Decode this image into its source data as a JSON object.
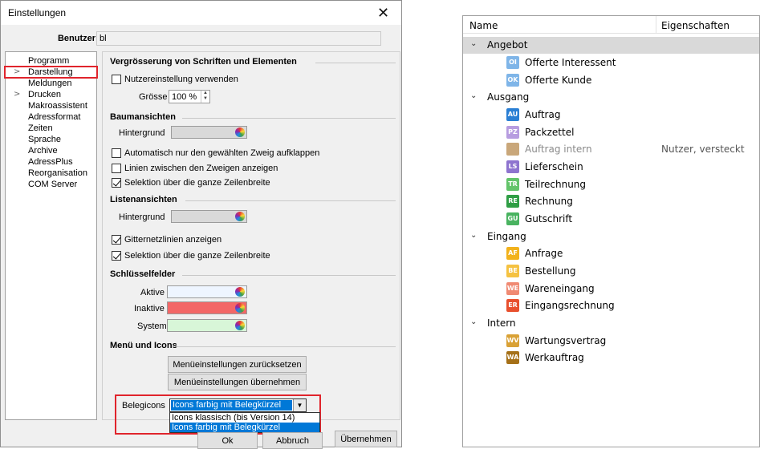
{
  "dialog": {
    "title": "Einstellungen",
    "close_glyph": "✕",
    "user_label": "Benutzer",
    "user_value": "bl"
  },
  "nav": {
    "items": [
      {
        "label": "Programm",
        "expandable": false
      },
      {
        "label": "Darstellung",
        "expandable": true,
        "selected": true
      },
      {
        "label": "Meldungen",
        "expandable": false
      },
      {
        "label": "Drucken",
        "expandable": true
      },
      {
        "label": "Makroassistent",
        "expandable": false
      },
      {
        "label": "Adressformat",
        "expandable": false
      },
      {
        "label": "Zeiten",
        "expandable": false
      },
      {
        "label": "Sprache",
        "expandable": false
      },
      {
        "label": "Archive",
        "expandable": false
      },
      {
        "label": "AdressPlus",
        "expandable": false
      },
      {
        "label": "Reorganisation",
        "expandable": false
      },
      {
        "label": "COM Server",
        "expandable": false
      }
    ]
  },
  "sections": {
    "zoom": {
      "title": "Vergrösserung von Schriften und Elementen",
      "use_user_setting": "Nutzereinstellung verwenden",
      "size_label": "Grösse",
      "size_value": "100 %"
    },
    "tree_views": {
      "title": "Baumansichten",
      "background_label": "Hintergrund",
      "auto_expand": "Automatisch nur den gewählten Zweig aufklappen",
      "lines_between": "Linien zwischen den Zweigen anzeigen",
      "full_row_select": "Selektion über die ganze Zeilenbreite"
    },
    "list_views": {
      "title": "Listenansichten",
      "background_label": "Hintergrund",
      "grid_lines": "Gitternetzlinien anzeigen",
      "full_row_select": "Selektion über die ganze Zeilenbreite"
    },
    "key_fields": {
      "title": "Schlüsselfelder",
      "active_label": "Aktive",
      "inactive_label": "Inaktive",
      "system_label": "System"
    },
    "menu_icons": {
      "title": "Menü und Icons",
      "reset_button": "Menüeinstellungen zurücksetzen",
      "apply_button": "Menüeinstellungen übernehmen",
      "belegicons_label": "Belegicons",
      "belegicons_value": "Icons farbig mit Belegkürzel",
      "options": [
        "Icons klassisch (bis Version 14)",
        "Icons farbig mit Belegkürzel"
      ]
    }
  },
  "colors": {
    "tree_bg": "#d9d9d9",
    "list_bg": "#d9d9d9",
    "active": "#eef5ff",
    "inactive": "#f36767",
    "system": "#d8f6d8",
    "highlight_red": "#e0242c",
    "select_blue": "#0078d7"
  },
  "footer": {
    "ok": "Ok",
    "cancel": "Abbruch",
    "apply": "Übernehmen"
  },
  "tree": {
    "col_name": "Name",
    "col_props": "Eigenschaften",
    "groups": [
      {
        "label": "Angebot",
        "items": [
          {
            "label": "Offerte Interessent",
            "abbr": "OI",
            "color": "#7fb5e8"
          },
          {
            "label": "Offerte Kunde",
            "abbr": "OK",
            "color": "#7fb5e8"
          }
        ]
      },
      {
        "label": "Ausgang",
        "items": [
          {
            "label": "Auftrag",
            "abbr": "AU",
            "color": "#2a7fd4"
          },
          {
            "label": "Packzettel",
            "abbr": "PZ",
            "color": "#b79de0"
          },
          {
            "label": "Auftrag intern",
            "abbr": "",
            "color": "#c9a77a",
            "props": "Nutzer, versteckt",
            "muted": true
          },
          {
            "label": "Lieferschein",
            "abbr": "LS",
            "color": "#8e74cf"
          },
          {
            "label": "Teilrechnung",
            "abbr": "TR",
            "color": "#63c46a"
          },
          {
            "label": "Rechnung",
            "abbr": "RE",
            "color": "#2f9e45"
          },
          {
            "label": "Gutschrift",
            "abbr": "GU",
            "color": "#49b360"
          }
        ]
      },
      {
        "label": "Eingang",
        "items": [
          {
            "label": "Anfrage",
            "abbr": "AF",
            "color": "#f2b21c"
          },
          {
            "label": "Bestellung",
            "abbr": "BE",
            "color": "#f5c242"
          },
          {
            "label": "Wareneingang",
            "abbr": "WE",
            "color": "#f08a73"
          },
          {
            "label": "Eingangsrechnung",
            "abbr": "ER",
            "color": "#e8502e"
          }
        ]
      },
      {
        "label": "Intern",
        "items": [
          {
            "label": "Wartungsvertrag",
            "abbr": "WV",
            "color": "#d9a135"
          },
          {
            "label": "Werkauftrag",
            "abbr": "WA",
            "color": "#a57018"
          }
        ]
      }
    ]
  }
}
